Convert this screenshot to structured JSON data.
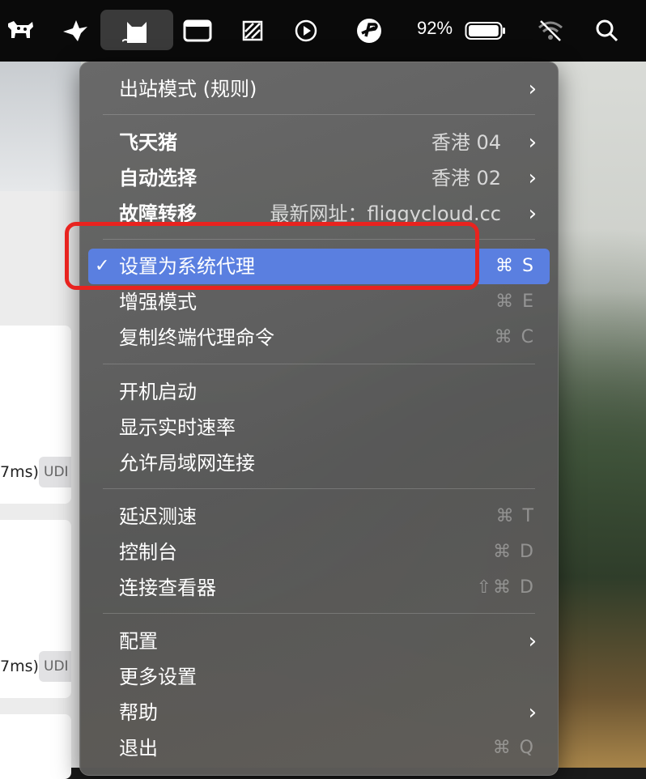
{
  "menubar": {
    "icons": [
      "cow-icon",
      "bird-icon",
      "clash-cat-icon",
      "window-icon",
      "striped-square-icon",
      "play-circle-icon",
      "proxy-p-icon"
    ],
    "battery_percent": "92%",
    "battery_level": 0.92
  },
  "background_window": {
    "rows": [
      {
        "latency": "7ms)",
        "badge": "UDI"
      },
      {
        "latency": "7ms)",
        "badge": "UDI"
      }
    ]
  },
  "menu": {
    "outbound_mode": "出站模式 (规则)",
    "groups": [
      {
        "label": "飞天猪",
        "value": "香港 04"
      },
      {
        "label": "自动选择",
        "value": "香港 02"
      },
      {
        "label": "故障转移",
        "value": "最新网址：fliggycloud.cc"
      }
    ],
    "set_system_proxy": {
      "label": "设置为系统代理",
      "shortcut": "⌘ S",
      "check": "✓"
    },
    "enhanced_mode": {
      "label": "增强模式",
      "shortcut": "⌘ E"
    },
    "copy_terminal": {
      "label": "复制终端代理命令",
      "shortcut": "⌘ C"
    },
    "launch_at_login": "开机启动",
    "show_speed": "显示实时速率",
    "allow_lan": "允许局域网连接",
    "latency_test": {
      "label": "延迟测速",
      "shortcut": "⌘ T"
    },
    "dashboard": {
      "label": "控制台",
      "shortcut": "⌘ D"
    },
    "connections": {
      "label": "连接查看器",
      "shortcut": "⇧⌘ D"
    },
    "config": "配置",
    "more_settings": "更多设置",
    "help": "帮助",
    "quit": {
      "label": "退出",
      "shortcut": "⌘ Q"
    },
    "chevron": "›"
  },
  "colors": {
    "highlight": "#5a7fe0",
    "annotation_box": "#e8231f"
  }
}
